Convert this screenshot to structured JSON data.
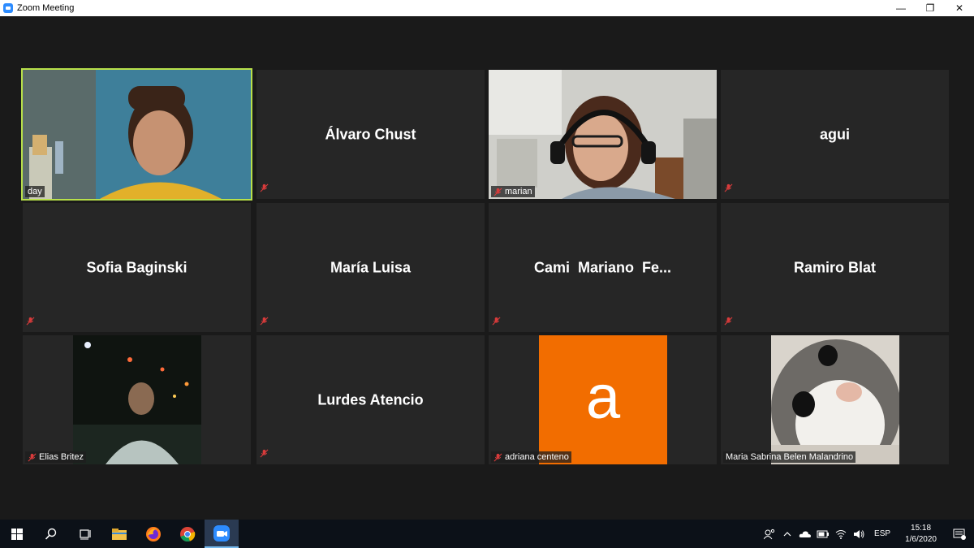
{
  "window": {
    "title": "Zoom Meeting",
    "controls": {
      "minimize": "—",
      "restore": "❐",
      "close": "✕"
    }
  },
  "participants": [
    {
      "id": "day",
      "label": "day",
      "type": "video",
      "active": true,
      "muted": false
    },
    {
      "id": "alvaro",
      "display_name": "Álvaro Chust",
      "type": "name",
      "muted": true
    },
    {
      "id": "marian",
      "label": "marian",
      "type": "video",
      "muted": true
    },
    {
      "id": "agui",
      "display_name": "agui",
      "type": "name",
      "muted": true
    },
    {
      "id": "sofia",
      "display_name": "Sofia Baginski",
      "type": "name",
      "muted": true
    },
    {
      "id": "maria-luisa",
      "display_name": "María Luisa",
      "type": "name",
      "muted": true
    },
    {
      "id": "cami",
      "display_name": "Cami  Mariano  Fe...",
      "type": "name",
      "muted": true
    },
    {
      "id": "ramiro",
      "display_name": "Ramiro Blat",
      "type": "name",
      "muted": true
    },
    {
      "id": "elias",
      "label": "Elias Britez",
      "type": "video",
      "muted": true
    },
    {
      "id": "lurdes",
      "display_name": "Lurdes Atencio",
      "type": "name",
      "muted": true
    },
    {
      "id": "adriana",
      "label": "adriana centeno",
      "avatar_letter": "a",
      "avatar_color": "#f26d00",
      "type": "avatar",
      "muted": true
    },
    {
      "id": "sabrina",
      "label": "Maria Sabrina Belen Malandrino",
      "type": "video",
      "muted": false
    }
  ],
  "taskbar": {
    "apps": [
      "start-icon",
      "search-icon",
      "task-view-icon",
      "file-explorer-icon",
      "firefox-icon",
      "chrome-icon",
      "zoom-icon"
    ],
    "tray": {
      "language": "ESP",
      "time": "15:18",
      "date": "1/6/2020"
    }
  },
  "colors": {
    "active_speaker": "#b8e04a",
    "mute_red": "#d83b3b",
    "tile_bg": "#262626"
  }
}
